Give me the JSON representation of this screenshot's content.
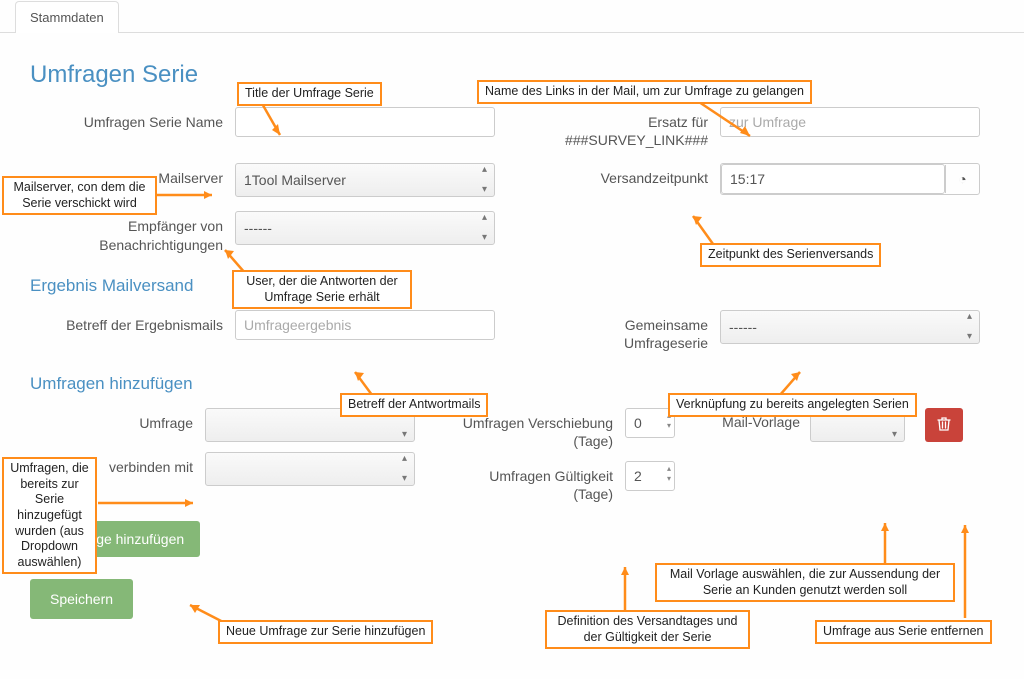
{
  "tab": {
    "label": "Stammdaten"
  },
  "sections": {
    "main": "Umfragen Serie",
    "result": "Ergebnis Mailversand",
    "add": "Umfragen hinzufügen"
  },
  "labels": {
    "serie_name": "Umfragen Serie Name",
    "mailserver": "Mailserver",
    "recipients": "Empfänger von Benachrichtigungen",
    "replace": "Ersatz für ###SURVEY_LINK###",
    "sendtime": "Versandzeitpunkt",
    "result_subject": "Betreff der Ergebnismails",
    "shared_series": "Gemeinsame Umfrageserie",
    "survey": "Umfrage",
    "connect": "verbinden mit",
    "shift": "Umfragen Verschiebung (Tage)",
    "validity": "Umfragen Gültigkeit (Tage)",
    "mailtemplate": "Mail-Vorlage"
  },
  "values": {
    "mailserver_selected": "1Tool Mailserver",
    "recipients_selected": "------",
    "replace_placeholder": "zur Umfrage",
    "sendtime_value": "15:17",
    "result_subject_placeholder": "Umfrageergebnis",
    "shared_series_selected": "------",
    "shift_value": "0",
    "validity_value": "2"
  },
  "buttons": {
    "add_survey": "Umfrage hinzufügen",
    "save": "Speichern"
  },
  "annotations": {
    "a1": "Title der Umfrage Serie",
    "a2": "Name des Links in der Mail, um zur Umfrage zu gelangen",
    "a3": "Mailserver, con dem die Serie verschickt wird",
    "a4": "User, der die Antworten der Umfrage Serie erhält",
    "a5": "Zeitpunkt des Serienversands",
    "a6": "Betreff der Antwortmails",
    "a7": "Verknüpfung zu bereits angelegten Serien",
    "a8": "Umfragen, die bereits zur Serie hinzugefügt wurden (aus Dropdown auswählen)",
    "a9": "Neue Umfrage zur Serie hinzufügen",
    "a10": "Definition des Versandtages und der Gültigkeit der Serie",
    "a11": "Mail Vorlage auswählen, die zur Aussendung der Serie an Kunden genutzt werden soll",
    "a12": "Umfrage aus Serie entfernen"
  }
}
